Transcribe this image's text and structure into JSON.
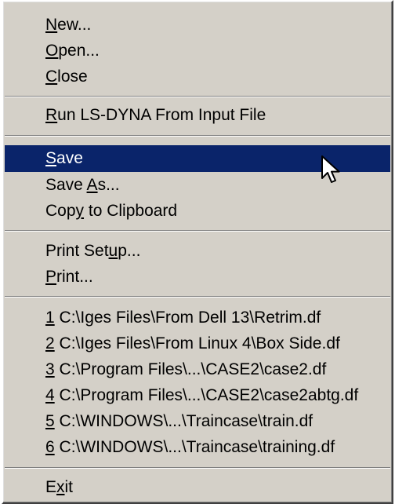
{
  "menu": {
    "items": [
      {
        "pre": "",
        "key": "N",
        "post": "ew..."
      },
      {
        "pre": "",
        "key": "O",
        "post": "pen..."
      },
      {
        "pre": "",
        "key": "C",
        "post": "lose"
      },
      {
        "pre": "",
        "key": "R",
        "post": "un LS-DYNA From Input File"
      },
      {
        "pre": "",
        "key": "S",
        "post": "ave"
      },
      {
        "pre": "Save ",
        "key": "A",
        "post": "s..."
      },
      {
        "pre": "Cop",
        "key": "y",
        "post": " to Clipboard"
      },
      {
        "pre": "Print Set",
        "key": "u",
        "post": "p..."
      },
      {
        "pre": "",
        "key": "P",
        "post": "rint..."
      },
      {
        "pre": "",
        "key": "1",
        "post": " C:\\Iges Files\\From Dell 13\\Retrim.df"
      },
      {
        "pre": "",
        "key": "2",
        "post": " C:\\Iges Files\\From Linux 4\\Box Side.df"
      },
      {
        "pre": "",
        "key": "3",
        "post": " C:\\Program Files\\...\\CASE2\\case2.df"
      },
      {
        "pre": "",
        "key": "4",
        "post": " C:\\Program Files\\...\\CASE2\\case2abtg.df"
      },
      {
        "pre": "",
        "key": "5",
        "post": " C:\\WINDOWS\\...\\Traincase\\train.df"
      },
      {
        "pre": "",
        "key": "6",
        "post": " C:\\WINDOWS\\...\\Traincase\\training.df"
      },
      {
        "pre": "E",
        "key": "x",
        "post": "it"
      }
    ],
    "highlighted_item": "Save"
  },
  "colors": {
    "menu_background": "#d4d0c8",
    "highlight_background": "#0a246a",
    "highlight_text": "#ffffff",
    "text": "#000000"
  },
  "cursor_icon": "arrow-pointer-icon"
}
